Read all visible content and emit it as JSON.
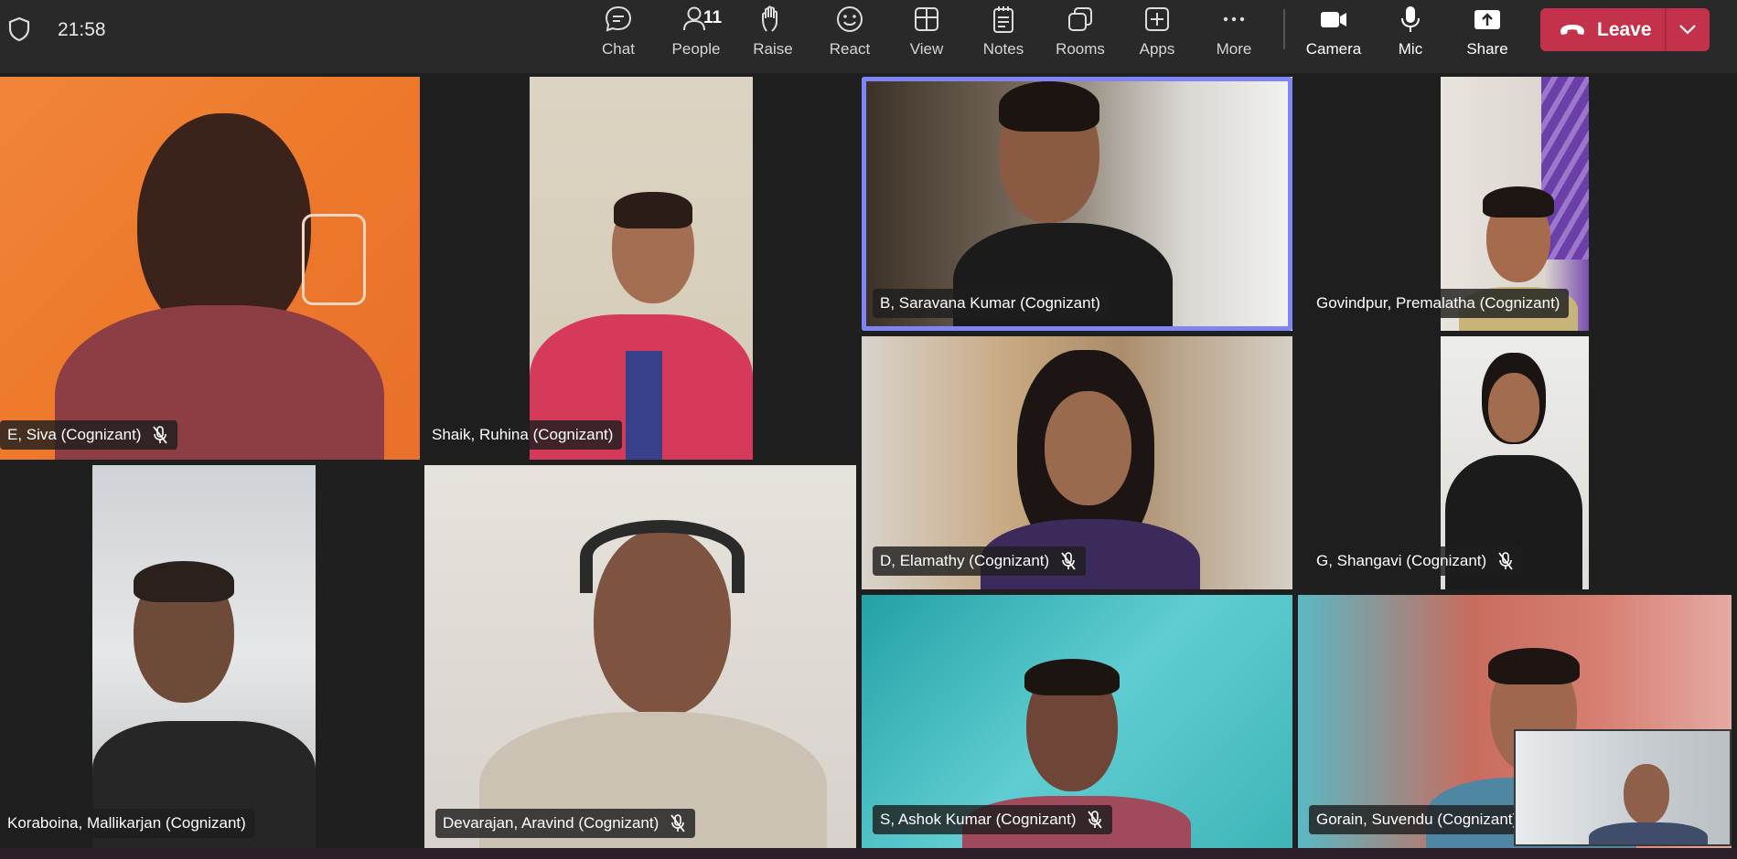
{
  "topbar": {
    "time": "21:58",
    "buttons": [
      {
        "label": "Chat",
        "icon": "chat-icon"
      },
      {
        "label": "People",
        "icon": "people-icon",
        "count": "11"
      },
      {
        "label": "Raise",
        "icon": "raise-hand-icon"
      },
      {
        "label": "React",
        "icon": "react-smiley-icon"
      },
      {
        "label": "View",
        "icon": "view-grid-icon"
      },
      {
        "label": "Notes",
        "icon": "notes-icon"
      },
      {
        "label": "Rooms",
        "icon": "rooms-icon"
      },
      {
        "label": "Apps",
        "icon": "apps-plus-icon"
      },
      {
        "label": "More",
        "icon": "more-dots-icon"
      },
      {
        "label": "Camera",
        "icon": "camera-icon"
      },
      {
        "label": "Mic",
        "icon": "mic-icon"
      },
      {
        "label": "Share",
        "icon": "share-icon"
      }
    ],
    "leave_label": "Leave"
  },
  "participants": [
    {
      "name": "E, Siva (Cognizant)",
      "muted": true
    },
    {
      "name": "Shaik, Ruhina (Cognizant)",
      "muted": false
    },
    {
      "name": "B, Saravana Kumar (Cognizant)",
      "muted": false,
      "speaking": true
    },
    {
      "name": "Govindpur, Premalatha (Cognizant)",
      "muted": false
    },
    {
      "name": "D, Elamathy (Cognizant)",
      "muted": true
    },
    {
      "name": "G, Shangavi (Cognizant)",
      "muted": true
    },
    {
      "name": "Koraboina, Mallikarjan (Cognizant)",
      "muted": false
    },
    {
      "name": "Devarajan, Aravind (Cognizant)",
      "muted": true
    },
    {
      "name": "S, Ashok Kumar (Cognizant)",
      "muted": true
    },
    {
      "name": "Gorain, Suvendu (Cognizant)",
      "muted": true
    }
  ],
  "colors": {
    "accent_speaking": "#7f85f5",
    "leave": "#c4314b",
    "background": "#1f1f1f"
  }
}
